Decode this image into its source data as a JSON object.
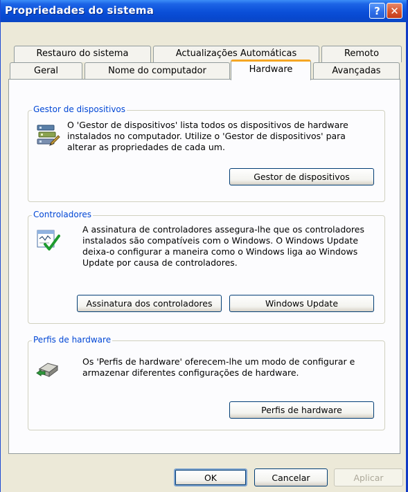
{
  "window": {
    "title": "Propriedades do sistema",
    "help_label": "?",
    "close_label": "✕"
  },
  "tabs": {
    "row1": [
      "Restauro do sistema",
      "Actualizações Automáticas",
      "Remoto"
    ],
    "row2": [
      "Geral",
      "Nome do computador",
      "Hardware",
      "Avançadas"
    ],
    "active": "Hardware"
  },
  "groups": {
    "device_manager": {
      "title": "Gestor de dispositivos",
      "text": "O 'Gestor de dispositivos' lista todos os dispositivos de hardware instalados no computador. Utilize o 'Gestor de dispositivos' para alterar as propriedades de cada um.",
      "button": "Gestor de dispositivos",
      "icon": "device-manager-icon"
    },
    "drivers": {
      "title": "Controladores",
      "text": "A assinatura de controladores assegura-lhe que os controladores instalados são compatíveis com o Windows. O Windows Update deixa-o configurar a maneira como o Windows liga ao Windows Update por causa de controladores.",
      "button_signing": "Assinatura dos controladores",
      "button_update": "Windows Update",
      "icon": "driver-signing-icon"
    },
    "hardware_profiles": {
      "title": "Perfis de hardware",
      "text": "Os 'Perfis de hardware' oferecem-lhe um modo de configurar e armazenar diferentes configurações de hardware.",
      "button": "Perfis de hardware",
      "icon": "hardware-profiles-icon"
    }
  },
  "footer": {
    "ok": "OK",
    "cancel": "Cancelar",
    "apply": "Aplicar"
  },
  "colors": {
    "titlebar": "#0A4FD8",
    "group_title": "#0046D5",
    "active_tab_highlight": "#F5A623",
    "dialog_bg": "#ECE9D8"
  }
}
